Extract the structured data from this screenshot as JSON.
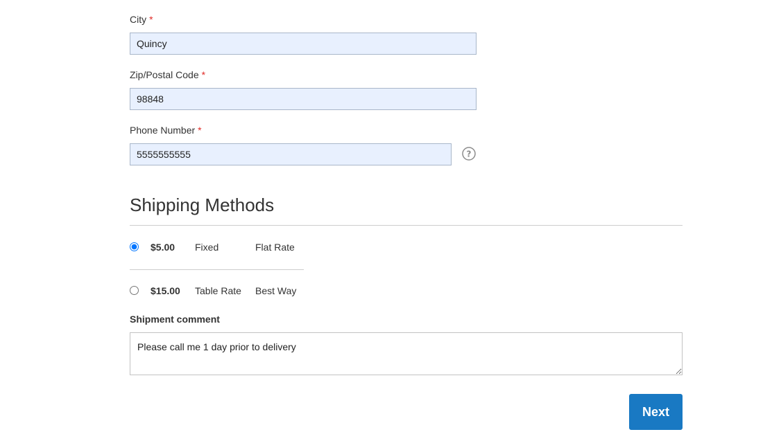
{
  "address": {
    "city": {
      "label": "City",
      "required_mark": "*",
      "value": "Quincy"
    },
    "zip": {
      "label": "Zip/Postal Code",
      "required_mark": "*",
      "value": "98848"
    },
    "phone": {
      "label": "Phone Number",
      "required_mark": "*",
      "value": "5555555555",
      "help_icon": "question-circle-icon"
    }
  },
  "shipping": {
    "title": "Shipping Methods",
    "methods": [
      {
        "price": "$5.00",
        "carrier": "Fixed",
        "method": "Flat Rate",
        "selected": true
      },
      {
        "price": "$15.00",
        "carrier": "Table Rate",
        "method": "Best Way",
        "selected": false
      }
    ]
  },
  "comment": {
    "label": "Shipment comment",
    "value": "Please call me 1 day prior to delivery"
  },
  "actions": {
    "next_label": "Next"
  },
  "colors": {
    "accent": "#1979c3",
    "required": "#e02b27",
    "autofill_bg": "#e8f0fe"
  }
}
